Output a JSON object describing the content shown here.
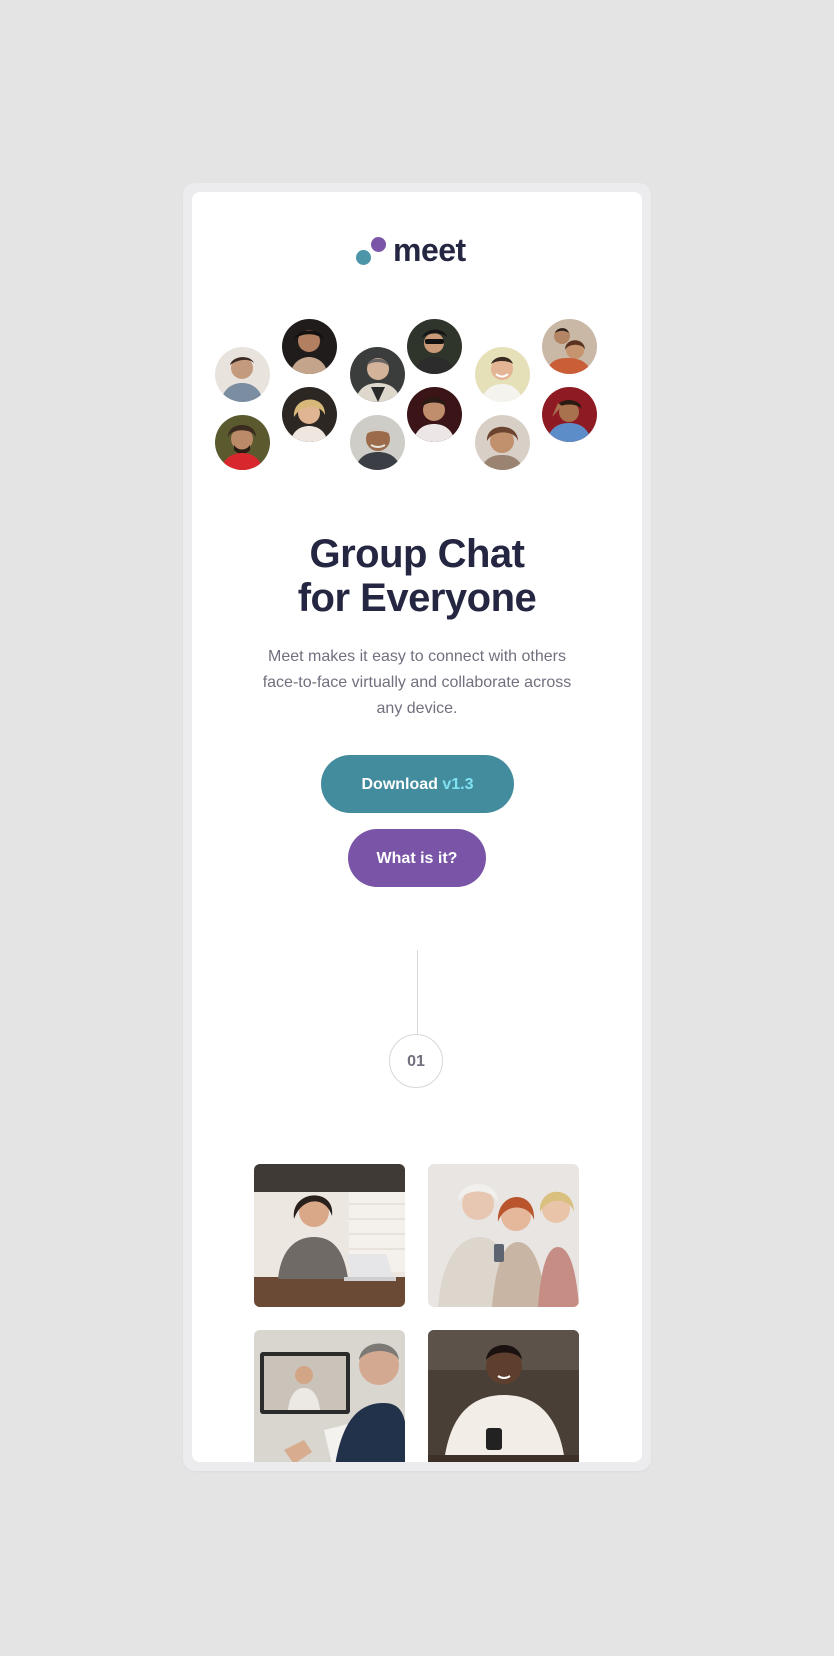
{
  "brand": {
    "name": "meet",
    "accent_teal": "#4d96a9",
    "accent_purple": "#7b55a7",
    "text_dark": "#252641"
  },
  "hero": {
    "title_line1": "Group Chat",
    "title_line2": "for Everyone",
    "description": "Meet makes it easy to connect with others face-to-face virtually and collaborate across any device."
  },
  "buttons": {
    "download_label": "Download",
    "download_version": "v1.3",
    "what_label": "What is it?"
  },
  "step": {
    "number": "01"
  },
  "avatars": [
    {
      "name": "avatar-man-1"
    },
    {
      "name": "avatar-woman-1"
    },
    {
      "name": "avatar-man-2"
    },
    {
      "name": "avatar-man-3"
    },
    {
      "name": "avatar-man-4"
    },
    {
      "name": "avatar-couple"
    },
    {
      "name": "avatar-man-5"
    },
    {
      "name": "avatar-woman-2"
    },
    {
      "name": "avatar-man-6"
    },
    {
      "name": "avatar-man-7"
    },
    {
      "name": "avatar-man-8"
    },
    {
      "name": "avatar-woman-3"
    }
  ],
  "photos": [
    "woman-laptop-photo",
    "women-phone-photo",
    "video-call-photo",
    "man-phone-photo"
  ]
}
